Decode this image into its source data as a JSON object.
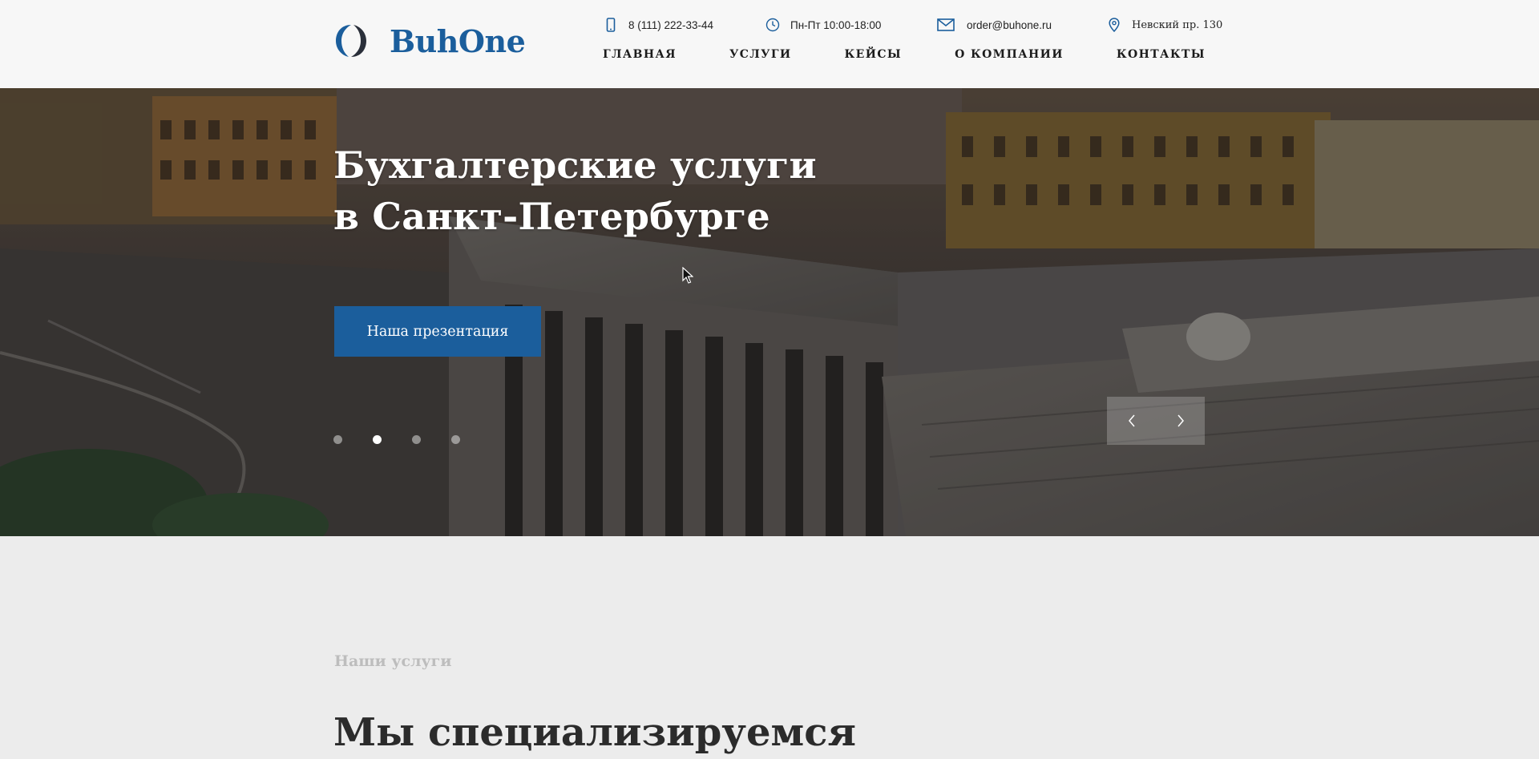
{
  "brand": {
    "name": "BuhOne",
    "color": "#1b5e9c"
  },
  "contacts": {
    "phone": {
      "icon": "phone-icon",
      "text": "8 (111) 222-33-44"
    },
    "hours": {
      "icon": "clock-icon",
      "text": "Пн-Пт 10:00-18:00"
    },
    "email": {
      "icon": "mail-icon",
      "text": "order@buhone.ru"
    },
    "address": {
      "icon": "location-pin-icon",
      "text": "Невский пр. 130"
    }
  },
  "nav": {
    "items": [
      {
        "label": "ГЛАВНАЯ"
      },
      {
        "label": "УСЛУГИ"
      },
      {
        "label": "КЕЙСЫ"
      },
      {
        "label": "О КОМПАНИИ"
      },
      {
        "label": "КОНТАКТЫ"
      }
    ]
  },
  "hero": {
    "title_line1": "Бухгалтерские услуги",
    "title_line2": "в Санкт-Петербурге",
    "button_label": "Наша презентация",
    "slides_count": 4,
    "active_slide": 2,
    "prev_icon": "chevron-left-icon",
    "next_icon": "chevron-right-icon"
  },
  "services": {
    "kicker": "Наши услуги",
    "heading": "Мы специализируемся"
  }
}
